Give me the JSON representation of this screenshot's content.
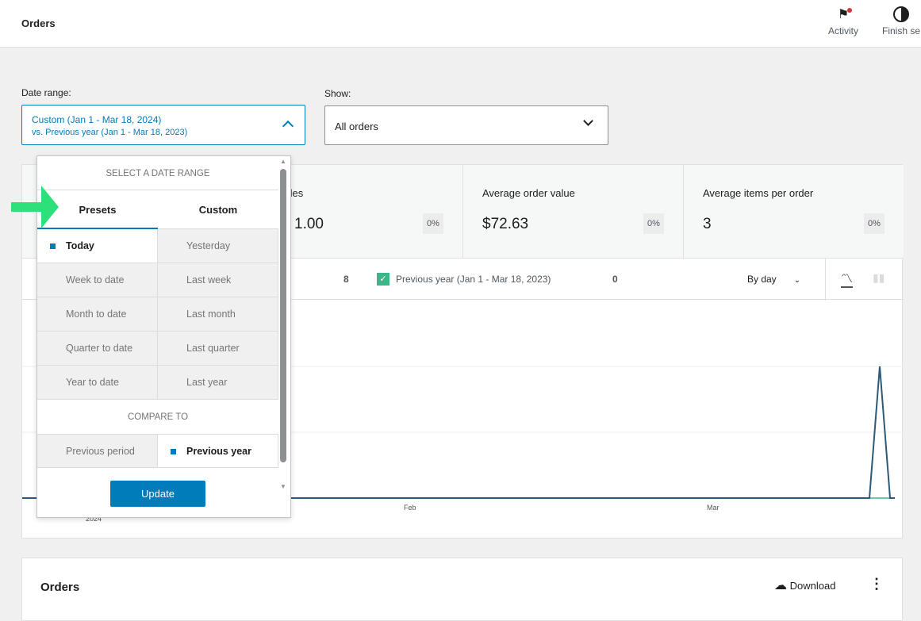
{
  "header": {
    "title": "Orders",
    "activity": "Activity",
    "finish_setup": "Finish se"
  },
  "filters": {
    "date_range_label": "Date range:",
    "date_range_value": "Custom (Jan 1 - Mar 18, 2024)",
    "date_range_compare": "vs. Previous year (Jan 1 - Mar 18, 2023)",
    "show_label": "Show:",
    "show_value": "All orders"
  },
  "stats": [
    {
      "label": "Net sales",
      "value": "1.00",
      "delta": "0%"
    },
    {
      "label": "Average order value",
      "value": "$72.63",
      "delta": "0%"
    },
    {
      "label": "Average items per order",
      "value": "3",
      "delta": "0%"
    }
  ],
  "legend": {
    "current_value": "8",
    "previous_label": "Previous year (Jan 1 - Mar 18, 2023)",
    "previous_value": "0",
    "interval": "By day"
  },
  "chart": {
    "x_labels": [
      "2024",
      "Feb",
      "Mar"
    ],
    "line_color": "#2c5a78",
    "compare_color": "#3eb489"
  },
  "popover": {
    "heading": "SELECT A DATE RANGE",
    "tabs": [
      "Presets",
      "Custom"
    ],
    "presets": [
      "Today",
      "Yesterday",
      "Week to date",
      "Last week",
      "Month to date",
      "Last month",
      "Quarter to date",
      "Last quarter",
      "Year to date",
      "Last year"
    ],
    "selected_preset": "Today",
    "compare_heading": "COMPARE TO",
    "compare": [
      "Previous period",
      "Previous year"
    ],
    "selected_compare": "Previous year",
    "update": "Update"
  },
  "orders_card": {
    "title": "Orders",
    "download": "Download"
  }
}
